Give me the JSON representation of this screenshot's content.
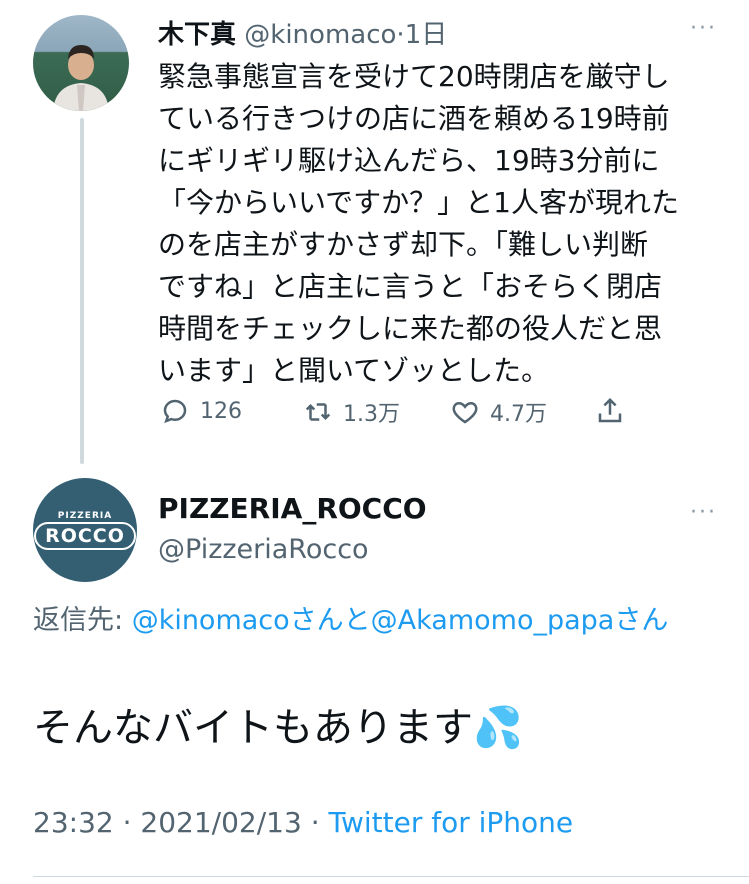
{
  "tweet1": {
    "name": "木下真",
    "handle": "@kinomaco",
    "separator": "·",
    "time": "1日",
    "more": "···",
    "lines": [
      "緊急事態宣言を受けて20時閉店を厳守し",
      "ている行きつけの店に酒を頼める19時前",
      "にギリギリ駆け込んだら、19時3分前に",
      "「今からいいですか？」と1人客が現れた",
      "のを店主がすかさず却下。「難しい判断",
      "ですね」と店主に言うと「おそらく閉店",
      "時間をチェックしに来た都の役人だと思",
      "います」と聞いてゾッとした。"
    ],
    "actions": {
      "reply_count": "126",
      "retweet_count": "1.3万",
      "like_count": "4.7万"
    }
  },
  "tweet2": {
    "name": "PIZZERIA_ROCCO",
    "handle": "@PizzeriaRocco",
    "more": "···",
    "avatar_text_small": "PIZZERIA",
    "avatar_text_big": "ROCCO",
    "reply_prefix": "返信先: ",
    "reply_mention1": "@kinomaco",
    "reply_joiner": "さんと",
    "reply_mention2": "@Akamomo_papa",
    "reply_suffix": "さん",
    "text": "そんなバイトもあります",
    "emoji": "💦",
    "time": "23:32",
    "dot1": " · ",
    "date": "2021/02/13",
    "dot2": " · ",
    "source": "Twitter for iPhone"
  },
  "colors": {
    "link": "#1d9bf0",
    "muted": "#536471",
    "avatar_bg": "#345f73"
  }
}
